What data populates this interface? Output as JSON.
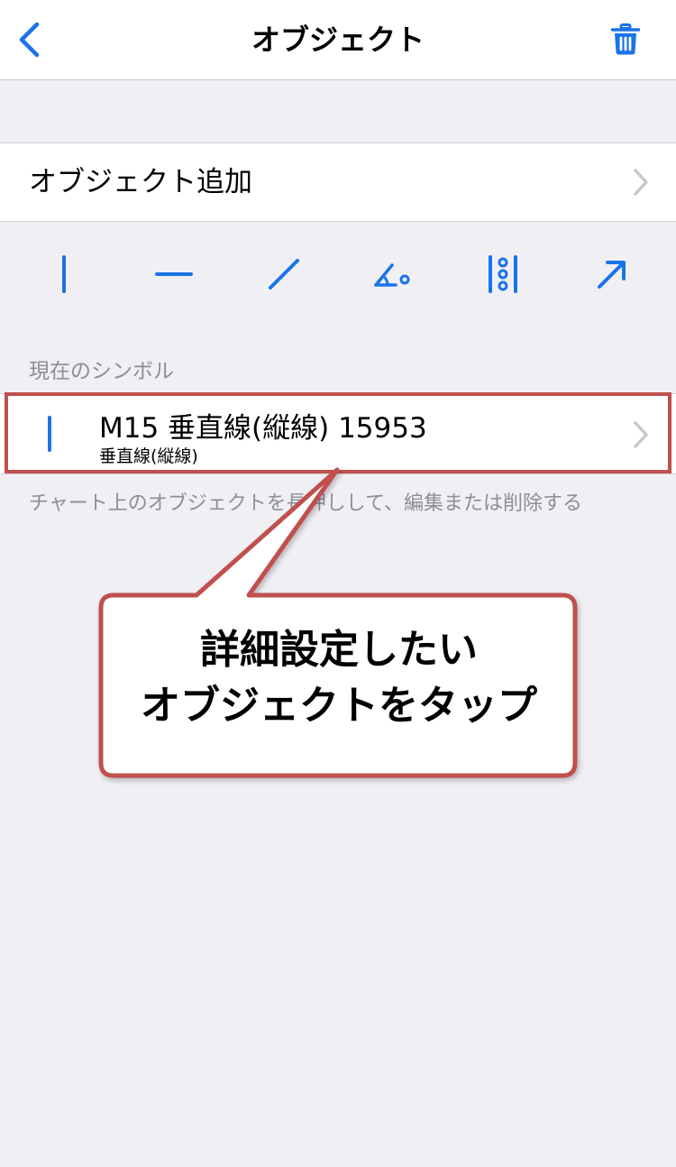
{
  "nav": {
    "title": "オブジェクト",
    "back_icon": "chevron-left-icon",
    "trash_icon": "trash-icon"
  },
  "add_object": {
    "label": "オブジェクト追加"
  },
  "tools": [
    {
      "name": "vertical-line-icon"
    },
    {
      "name": "horizontal-line-icon"
    },
    {
      "name": "trend-line-icon"
    },
    {
      "name": "angle-line-icon"
    },
    {
      "name": "fibonacci-icon"
    },
    {
      "name": "arrow-icon"
    }
  ],
  "current_symbol": {
    "header": "現在のシンボル",
    "item": {
      "title": "M15 垂直線(縦線) 15953",
      "subtitle": "垂直線(縦線)"
    },
    "note": "チャート上のオブジェクトを長押しして、編集または削除する"
  },
  "callout": {
    "line1": "詳細設定したい",
    "line2": "オブジェクトをタップ"
  },
  "colors": {
    "accent": "#1a73e8",
    "highlight": "#c0504d",
    "background": "#efeff4"
  }
}
